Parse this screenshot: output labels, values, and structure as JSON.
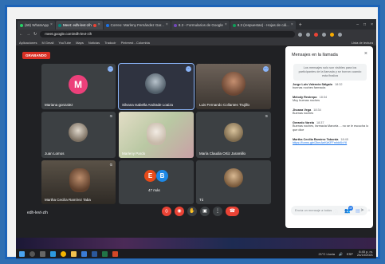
{
  "browser": {
    "tabs": [
      {
        "label": "(69) WhatsApp",
        "color": "#25d366"
      },
      {
        "label": "Meet: edh-levt-zih",
        "color": "#00897b",
        "active": true
      },
      {
        "label": "Correo: Marleny Fernández Gar...",
        "color": "#1a73e8"
      },
      {
        "label": "8.3 - Formularios de Google",
        "color": "#7248b9"
      },
      {
        "label": "8.3 (respuestas) - Hojas de cál...",
        "color": "#0f9d58"
      }
    ],
    "url": "meet.google.com/edh-levt-zih",
    "bookmarks": [
      "Aplicaciones",
      "M Gmail",
      "YouTube",
      "Maps",
      "Noticias",
      "Traducir",
      "Pinterest - Colombia"
    ],
    "reading_list": "Lista de lectura"
  },
  "meet": {
    "recording": "GRABANDO",
    "code": "edh-levt-zih",
    "tiles": [
      {
        "name": "Mariana gonzalez",
        "initial": "M",
        "color": "#ec407a"
      },
      {
        "name": "Silvana Isabella Andrade Loaiza"
      },
      {
        "name": "Luis Fernando Collantes Trujillo"
      },
      {
        "name": "Juan Lomos"
      },
      {
        "name": "Marleny Pardo"
      },
      {
        "name": "María Claudia Ortiz Jaramillo"
      },
      {
        "name": "Martha Cecilia Ramírez Taba"
      },
      {
        "name": "47 más",
        "initials": [
          "E",
          "B"
        ],
        "colors": [
          "#e64a19",
          "#1e88e5"
        ]
      },
      {
        "name": "Tú"
      }
    ],
    "chat": {
      "title": "Mensajes en la llamada",
      "note": "Los mensajes solo son visibles para los participantes de la llamada y se borran cuando esta finaliza",
      "messages": [
        {
          "sender": "Jorge Luis Valencia Sálgalo",
          "time": "18:32",
          "text": "buenas noches farmacia"
        },
        {
          "sender": "Melody Restrepo",
          "time": "18:34",
          "text": "Muy buenas noches"
        },
        {
          "sender": "Jhoana Vega",
          "time": "18:34",
          "text": "Buenas noches"
        },
        {
          "sender": "Gerardo Varela",
          "time": "18:37",
          "text": "Buenas noches, farmacia Marcela ... no se le escucha lo que dice"
        },
        {
          "sender": "Martha Cecilia Ramírez Taborda",
          "time": "18:45",
          "text": "https://forms.gle/2bmAeKkKFFmhkKbY6",
          "link": true
        }
      ],
      "input_placeholder": "Envía un mensaje a todos"
    },
    "participant_badge": "49"
  },
  "taskbar": {
    "weather": "21°C Lluvia",
    "time": "6:45 p. m.",
    "date": "24/10/2021",
    "lang": "ESP"
  }
}
